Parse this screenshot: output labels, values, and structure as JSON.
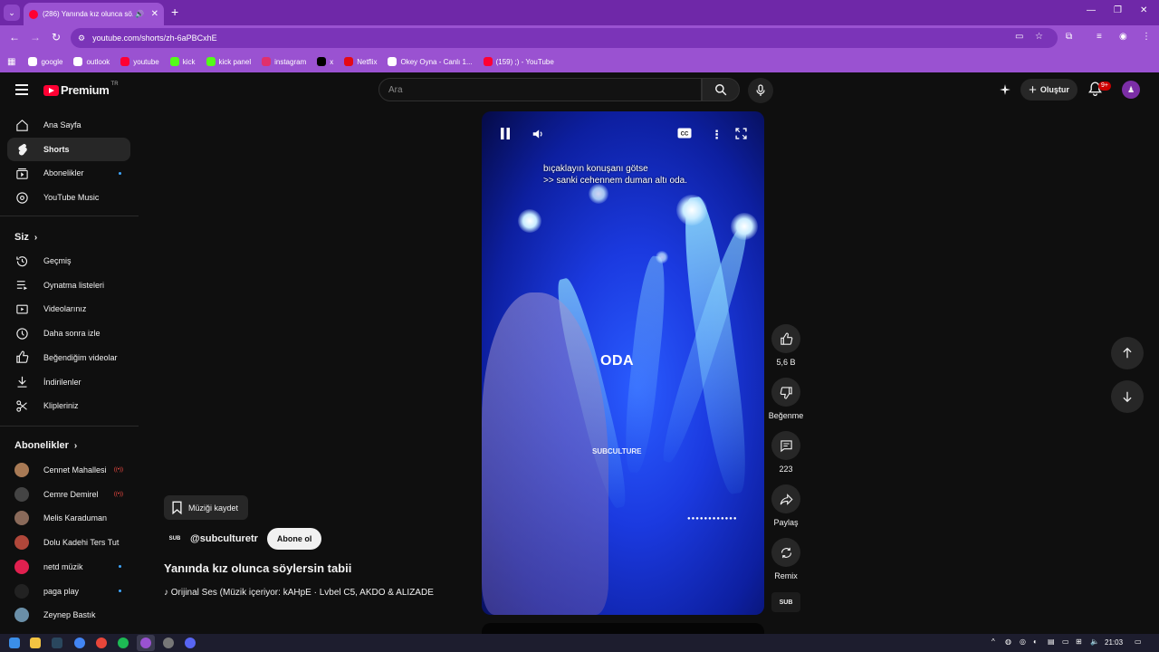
{
  "browser": {
    "tab_title": "(286) Yanında kız olunca sö...",
    "url": "youtube.com/shorts/zh-6aPBCxhE",
    "bookmarks": [
      {
        "label": "google",
        "color": "#ffffff"
      },
      {
        "label": "outlook",
        "color": "#ffffff"
      },
      {
        "label": "youtube",
        "color": "#ff0033"
      },
      {
        "label": "kick",
        "color": "#53fc18"
      },
      {
        "label": "kick panel",
        "color": "#53fc18"
      },
      {
        "label": "instagram",
        "color": "#e1306c"
      },
      {
        "label": "x",
        "color": "#000000"
      },
      {
        "label": "Netflix",
        "color": "#e50914"
      },
      {
        "label": "Okey Oyna - Canlı 1...",
        "color": "#ffffff"
      },
      {
        "label": "(159) ;) - YouTube",
        "color": "#ff0033"
      }
    ]
  },
  "header": {
    "logo_text": "Premium",
    "logo_region": "TR",
    "search_placeholder": "Ara",
    "create_label": "Oluştur",
    "notif_count": "9+"
  },
  "sidebar": {
    "main": [
      {
        "label": "Ana Sayfa",
        "icon": "home-icon"
      },
      {
        "label": "Shorts",
        "icon": "shorts-icon",
        "active": true
      },
      {
        "label": "Abonelikler",
        "icon": "subscriptions-icon"
      },
      {
        "label": "YouTube Music",
        "icon": "music-icon"
      }
    ],
    "you_heading": "Siz",
    "you": [
      {
        "label": "Geçmiş",
        "icon": "history-icon"
      },
      {
        "label": "Oynatma listeleri",
        "icon": "playlists-icon"
      },
      {
        "label": "Videolarınız",
        "icon": "your-videos-icon"
      },
      {
        "label": "Daha sonra izle",
        "icon": "watch-later-icon"
      },
      {
        "label": "Beğendiğim videolar",
        "icon": "liked-icon"
      },
      {
        "label": "İndirilenler",
        "icon": "downloads-icon"
      },
      {
        "label": "Klipleriniz",
        "icon": "clips-icon"
      }
    ],
    "subs_heading": "Abonelikler",
    "subs": [
      {
        "label": "Cennet Mahallesi",
        "color": "#a87a55"
      },
      {
        "label": "Cemre Demirel",
        "color": "#444444"
      },
      {
        "label": "Melis Karaduman",
        "color": "#8a6a5a"
      },
      {
        "label": "Dolu Kadehi Ters Tut",
        "color": "#b0473a"
      },
      {
        "label": "netd müzik",
        "color": "#e0204f"
      },
      {
        "label": "paga play",
        "color": "#222222"
      },
      {
        "label": "Zeynep Bastık",
        "color": "#6a8fa8"
      }
    ]
  },
  "video": {
    "subtitle_line1": "bıçaklayın konuşanı götse",
    "subtitle_line2": ">> sanki cehennem duman altı oda.",
    "overlay_title": "ODA",
    "overlay_brand": "SUBCULTURE"
  },
  "actions": {
    "like_count": "5,6 B",
    "dislike_label": "Beğenme",
    "comment_count": "223",
    "share_label": "Paylaş",
    "remix_label": "Remix",
    "channel_logo": "SUB"
  },
  "short_info": {
    "save_music_label": "Müziği kaydet",
    "channel_handle": "@subculturetr",
    "subscribe_label": "Abone ol",
    "title": "Yanında kız olunca söylersin tabii",
    "music": "♪ Orijinal Ses (Müzik içeriyor: kAHpE · Lvbel C5, AKDO & ALIZADE"
  },
  "taskbar": {
    "time": "21:03"
  }
}
